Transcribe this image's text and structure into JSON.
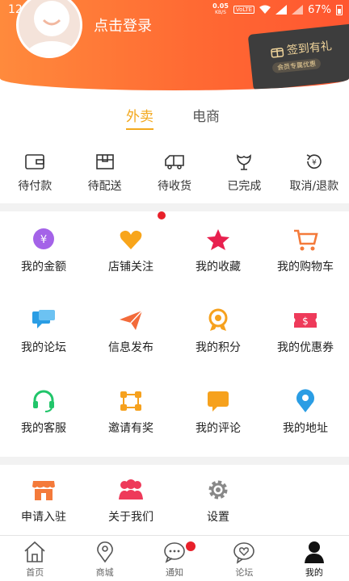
{
  "status_bar": {
    "time": "12:04",
    "speed": "0.05",
    "speed_unit": "KB/S",
    "volte": "VoLTE",
    "battery": "67%"
  },
  "header": {
    "login_text": "点击登录",
    "checkin_title": "签到有礼",
    "checkin_sub": "会员专属优惠"
  },
  "tabs": [
    {
      "label": "外卖",
      "active": true
    },
    {
      "label": "电商",
      "active": false
    }
  ],
  "orders": [
    {
      "label": "待付款",
      "icon": "wallet-icon"
    },
    {
      "label": "待配送",
      "icon": "package-icon"
    },
    {
      "label": "待收货",
      "icon": "truck-icon"
    },
    {
      "label": "已完成",
      "icon": "flower-icon"
    },
    {
      "label": "取消/退款",
      "icon": "refund-icon"
    }
  ],
  "menu": [
    {
      "label": "我的金额",
      "icon": "money-icon"
    },
    {
      "label": "店铺关注",
      "icon": "heart-icon"
    },
    {
      "label": "我的收藏",
      "icon": "star-icon"
    },
    {
      "label": "我的购物车",
      "icon": "cart-icon"
    },
    {
      "label": "我的论坛",
      "icon": "chat-icon"
    },
    {
      "label": "信息发布",
      "icon": "paper-plane-icon"
    },
    {
      "label": "我的积分",
      "icon": "medal-icon"
    },
    {
      "label": "我的优惠券",
      "icon": "coupon-icon"
    },
    {
      "label": "我的客服",
      "icon": "headset-icon"
    },
    {
      "label": "邀请有奖",
      "icon": "share-icon"
    },
    {
      "label": "我的评论",
      "icon": "comment-icon"
    },
    {
      "label": "我的地址",
      "icon": "location-icon"
    }
  ],
  "menu2": [
    {
      "label": "申请入驻",
      "icon": "store-icon"
    },
    {
      "label": "关于我们",
      "icon": "people-icon"
    },
    {
      "label": "设置",
      "icon": "gear-icon"
    }
  ],
  "nav": [
    {
      "label": "首页",
      "icon": "home-icon"
    },
    {
      "label": "商城",
      "icon": "map-icon"
    },
    {
      "label": "通知",
      "icon": "notification-icon"
    },
    {
      "label": "论坛",
      "icon": "forum-icon"
    },
    {
      "label": "我的",
      "icon": "user-icon",
      "active": true
    }
  ],
  "colors": {
    "accent": "#f2a81d",
    "header": "#ff6a33"
  }
}
